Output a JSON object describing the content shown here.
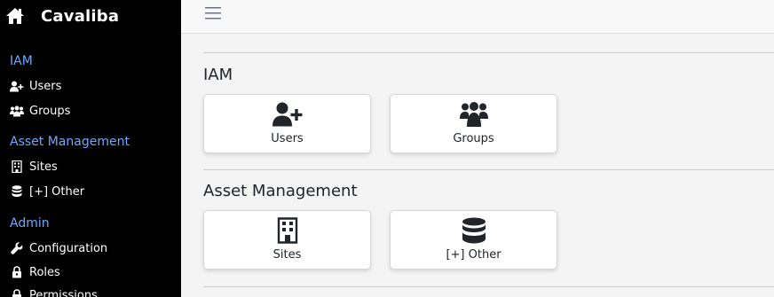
{
  "app": {
    "title": "Cavaliba"
  },
  "sidebar": {
    "sections": [
      {
        "title": "IAM",
        "items": [
          {
            "label": "Users",
            "icon": "user-plus-icon"
          },
          {
            "label": "Groups",
            "icon": "users-icon"
          }
        ]
      },
      {
        "title": "Asset Management",
        "items": [
          {
            "label": "Sites",
            "icon": "building-icon"
          },
          {
            "label": "[+] Other",
            "icon": "database-icon"
          }
        ]
      },
      {
        "title": "Admin",
        "items": [
          {
            "label": "Configuration",
            "icon": "wrench-icon"
          },
          {
            "label": "Roles",
            "icon": "user-lock-icon"
          },
          {
            "label": "Permissions",
            "icon": "lock-icon"
          }
        ]
      }
    ]
  },
  "main": {
    "groups": [
      {
        "title": "IAM",
        "cards": [
          {
            "label": "Users",
            "icon": "user-plus-icon"
          },
          {
            "label": "Groups",
            "icon": "users-icon"
          }
        ]
      },
      {
        "title": "Asset Management",
        "cards": [
          {
            "label": "Sites",
            "icon": "building-icon"
          },
          {
            "label": "[+] Other",
            "icon": "database-icon"
          }
        ]
      }
    ]
  },
  "colors": {
    "sidebar_bg": "#000000",
    "section_title": "#6ea8fe",
    "main_bg": "#f4f4f4",
    "card_bg": "#ffffff",
    "text": "#212529"
  }
}
